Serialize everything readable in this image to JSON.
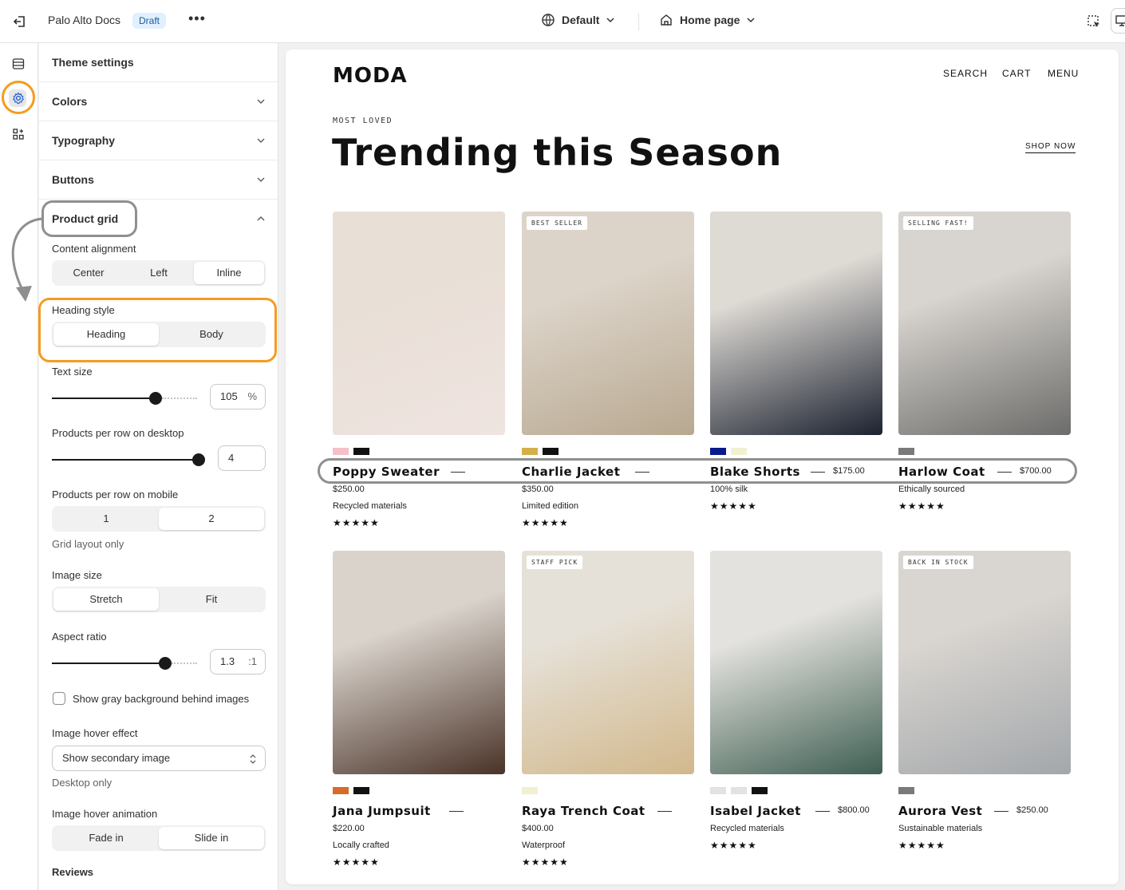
{
  "topbar": {
    "title": "Palo Alto Docs",
    "badge": "Draft",
    "more": "•••",
    "theme_select": "Default",
    "page_select": "Home page"
  },
  "panel": {
    "heading": "Theme settings",
    "sections": [
      "Colors",
      "Typography",
      "Buttons"
    ],
    "product_grid": {
      "title": "Product grid",
      "content_alignment": {
        "label": "Content alignment",
        "options": [
          "Center",
          "Left",
          "Inline"
        ],
        "selected": "Inline"
      },
      "heading_style": {
        "label": "Heading style",
        "options": [
          "Heading",
          "Body"
        ],
        "selected": "Heading"
      },
      "text_size": {
        "label": "Text size",
        "value": "105",
        "unit": "%",
        "level": 0.6
      },
      "per_row_desktop": {
        "label": "Products per row on desktop",
        "value": "4",
        "level": 1.0
      },
      "per_row_mobile": {
        "label": "Products per row on mobile",
        "options": [
          "1",
          "2"
        ],
        "selected": "2",
        "hint": "Grid layout only"
      },
      "image_size": {
        "label": "Image size",
        "options": [
          "Stretch",
          "Fit"
        ],
        "selected": "Stretch"
      },
      "aspect_ratio": {
        "label": "Aspect ratio",
        "value": "1.3",
        "unit": ":1",
        "level": 0.65
      },
      "gray_bg": {
        "label": "Show gray background behind images",
        "checked": false
      },
      "hover_effect": {
        "label": "Image hover effect",
        "value": "Show secondary image",
        "hint": "Desktop only"
      },
      "hover_animation": {
        "label": "Image hover animation",
        "options": [
          "Fade in",
          "Slide in"
        ],
        "selected": "Slide in"
      },
      "reviews": "Reviews"
    }
  },
  "preview": {
    "logo": "MODA",
    "nav": [
      "SEARCH",
      "CART",
      "MENU"
    ],
    "eyebrow": "MOST LOVED",
    "heading": "Trending this Season",
    "shop_now": "SHOP NOW",
    "products": [
      {
        "name": "Poppy Sweater",
        "price": "$250.00",
        "note": "Recycled materials",
        "tag": "",
        "swatches": [
          "#f6c0c8",
          "#111111"
        ],
        "stars": "★★★★★",
        "bg": [
          "#e8dfd6",
          "#efe4e0"
        ]
      },
      {
        "name": "Charlie Jacket",
        "price": "$350.00",
        "note": "Limited edition",
        "tag": "BEST SELLER",
        "swatches": [
          "#d4b04a",
          "#111111"
        ],
        "stars": "★★★★★",
        "bg": [
          "#dcd4c9",
          "#b8a890"
        ]
      },
      {
        "name": "Blake Shorts",
        "price": "$175.00",
        "note": "100% silk",
        "tag": "",
        "swatches": [
          "#0a1a8c",
          "#f1f0d0"
        ],
        "stars": "★★★★★",
        "bg": [
          "#dedad4",
          "#1c2230"
        ]
      },
      {
        "name": "Harlow Coat",
        "price": "$700.00",
        "note": "Ethically sourced",
        "tag": "SELLING FAST!",
        "swatches": [
          "#7a7a7a"
        ],
        "stars": "★★★★★",
        "bg": [
          "#d8d4cf",
          "#6c6c6a"
        ]
      },
      {
        "name": "Jana Jumpsuit",
        "price": "$220.00",
        "note": "Locally crafted",
        "tag": "",
        "swatches": [
          "#d86a2a",
          "#111111"
        ],
        "stars": "★★★★★",
        "bg": [
          "#d9d3cc",
          "#4a3328"
        ]
      },
      {
        "name": "Raya Trench Coat",
        "price": "$400.00",
        "note": "Waterproof",
        "tag": "STAFF PICK",
        "swatches": [
          "#f1f0d0"
        ],
        "stars": "★★★★★",
        "bg": [
          "#e6e1d8",
          "#d2b88c"
        ]
      },
      {
        "name": "Isabel Jacket",
        "price": "$800.00",
        "note": "Recycled materials",
        "tag": "",
        "swatches": [
          "#e2e2e2",
          "#e2e2e2",
          "#111111"
        ],
        "stars": "★★★★★",
        "bg": [
          "#e4e2de",
          "#3f5f52"
        ]
      },
      {
        "name": "Aurora Vest",
        "price": "$250.00",
        "note": "Sustainable materials",
        "tag": "BACK IN STOCK",
        "swatches": [
          "#7a7a7a"
        ],
        "stars": "★★★★★",
        "bg": [
          "#d9d5d0",
          "#a3a7ab"
        ]
      }
    ]
  }
}
